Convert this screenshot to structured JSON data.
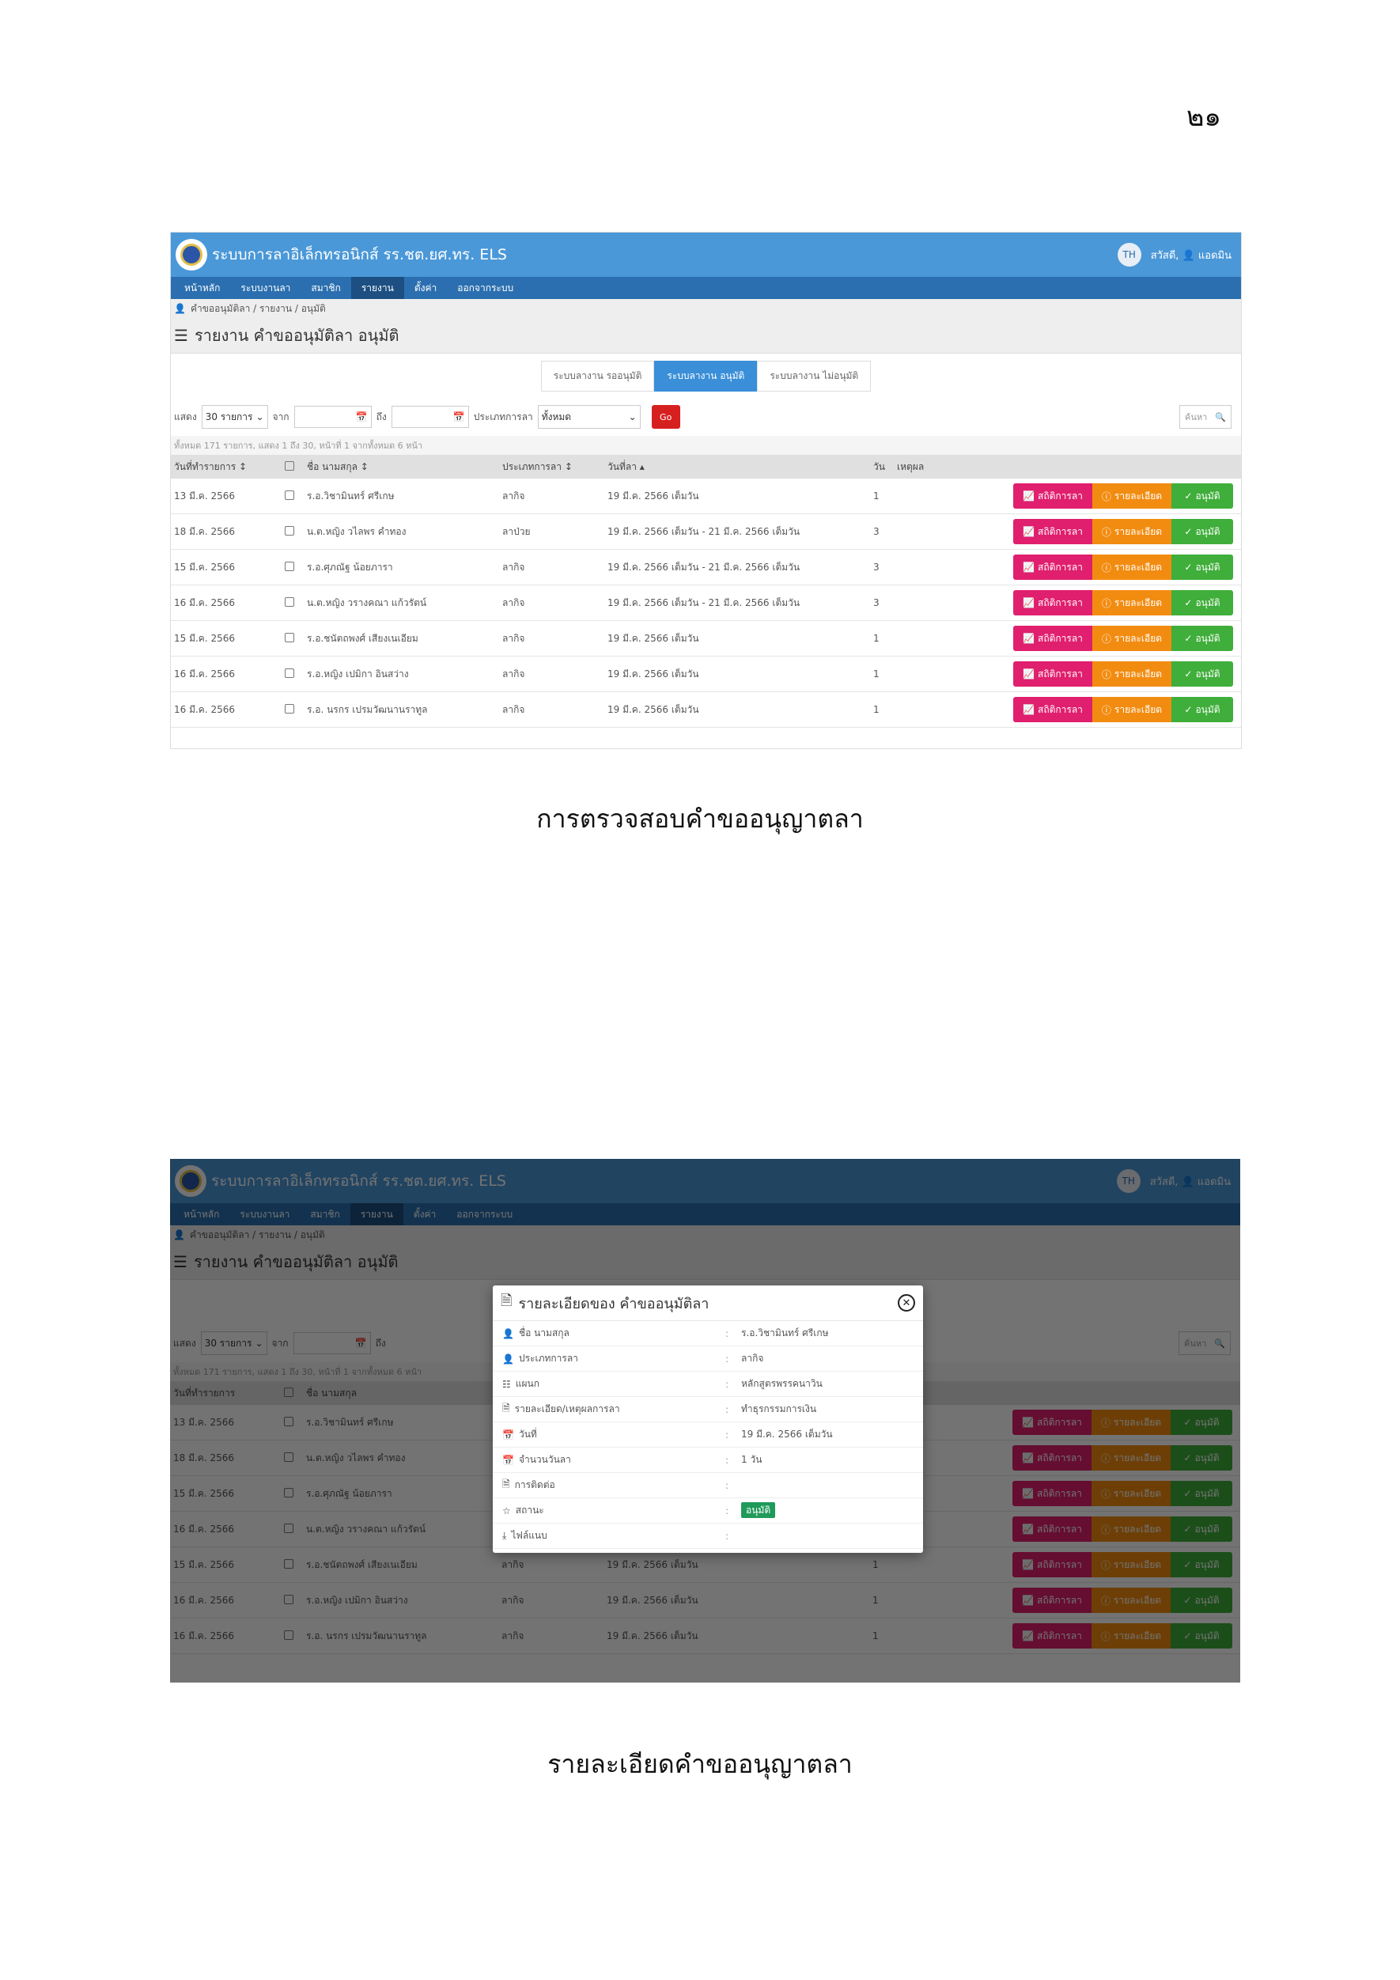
{
  "page": {
    "number": "๒๑",
    "caption1": "การตรวจสอบคำขออนุญาตลา",
    "caption2": "รายละเอียดคำขออนุญาตลา"
  },
  "colors": {
    "topbar": "#4a98d8",
    "navbar": "#2b6fb0",
    "stat_button": "#e01f6e",
    "detail_button": "#f28c11",
    "approve_button": "#3fae3a",
    "go_button": "#d62020",
    "status_badge": "#1f9a5a"
  },
  "app": {
    "title": "ระบบการลาอิเล็กทรอนิกส์ รร.ชต.ยศ.ทร. ELS",
    "lang": "TH",
    "greeting": "สวัสดี,",
    "user": "แอดมิน"
  },
  "nav": {
    "items": [
      "หน้าหลัก",
      "ระบบงานลา",
      "สมาชิก",
      "รายงาน",
      "ตั้งค่า",
      "ออกจากระบบ"
    ],
    "active_index": 3
  },
  "breadcrumb": "คำขออนุมัติลา / รายงาน / อนุมัติ",
  "page_title": "รายงาน คำขออนุมัติลา อนุมัติ",
  "tabs": [
    "ระบบลางาน รออนุมัติ",
    "ระบบลางาน อนุมัติ",
    "ระบบลางาน ไม่อนุมัติ"
  ],
  "tab_active_index": 1,
  "filter": {
    "show_label": "แสดง",
    "show_value": "30 รายการ",
    "from_label": "จาก",
    "to_label": "ถึง",
    "type_label": "ประเภทการลา",
    "type_value": "ทั้งหมด",
    "go": "Go",
    "search_placeholder": "ค้นหา"
  },
  "count_line": "ทั้งหมด 171 รายการ, แสดง 1 ถึง 30, หน้าที่ 1 จากทั้งหมด 6 หน้า",
  "table": {
    "headers": [
      "วันที่ทำรายการ",
      "ชื่อ นามสกุล",
      "ประเภทการลา",
      "วันที่ลา",
      "วัน",
      "เหตุผล"
    ],
    "rows": [
      [
        "13 มี.ค. 2566",
        "ร.อ.วิชามินทร์ ศรีเกษ",
        "ลากิจ",
        "19 มี.ค. 2566 เต็มวัน",
        "1"
      ],
      [
        "18 มี.ค. 2566",
        "น.ต.หญิง วไลพร คำทอง",
        "ลาป่วย",
        "19 มี.ค. 2566 เต็มวัน - 21 มี.ค. 2566 เต็มวัน",
        "3"
      ],
      [
        "15 มี.ค. 2566",
        "ร.อ.ศุภณัฐ น้อยภารา",
        "ลากิจ",
        "19 มี.ค. 2566 เต็มวัน - 21 มี.ค. 2566 เต็มวัน",
        "3"
      ],
      [
        "16 มี.ค. 2566",
        "น.ต.หญิง วรางคณา แก้วรัตน์",
        "ลากิจ",
        "19 มี.ค. 2566 เต็มวัน - 21 มี.ค. 2566 เต็มวัน",
        "3"
      ],
      [
        "15 มี.ค. 2566",
        "ร.อ.ชนัตถพงศ์ เสียงเนเอียม",
        "ลากิจ",
        "19 มี.ค. 2566 เต็มวัน",
        "1"
      ],
      [
        "16 มี.ค. 2566",
        "ร.อ.หญิง เปมิกา อินสว่าง",
        "ลากิจ",
        "19 มี.ค. 2566 เต็มวัน",
        "1"
      ],
      [
        "16 มี.ค. 2566",
        "ร.อ. นรกร เปรมวัฒนานราทูล",
        "ลากิจ",
        "19 มี.ค. 2566 เต็มวัน",
        "1"
      ]
    ],
    "actions": {
      "stat": "สถิติการลา",
      "detail": "รายละเอียด",
      "approve": "อนุมัติ"
    }
  },
  "modal": {
    "title": "รายละเอียดของ คำขออนุมัติลา",
    "rows": [
      {
        "label": "ชื่อ นามสกุล",
        "value": "ร.อ.วิชามินทร์ ศรีเกษ",
        "icon": "user-icon"
      },
      {
        "label": "ประเภทการลา",
        "value": "ลากิจ",
        "icon": "user-icon"
      },
      {
        "label": "แผนก",
        "value": "หลักสูตรพรรคนาวิน",
        "icon": "sitemap-icon"
      },
      {
        "label": "รายละเอียด/เหตุผลการลา",
        "value": "ทำธุรกรรมการเงิน",
        "icon": "file-icon"
      },
      {
        "label": "วันที่",
        "value": "19 มี.ค. 2566 เต็มวัน",
        "icon": "calendar-icon"
      },
      {
        "label": "จำนวนวันลา",
        "value": "1 วัน",
        "icon": "calendar-icon"
      },
      {
        "label": "การติดต่อ",
        "value": "",
        "icon": "file-icon"
      },
      {
        "label": "สถานะ",
        "value": "อนุมัติ",
        "icon": "star-icon"
      },
      {
        "label": "ไฟล์แนบ",
        "value": "",
        "icon": "download-icon"
      }
    ]
  }
}
